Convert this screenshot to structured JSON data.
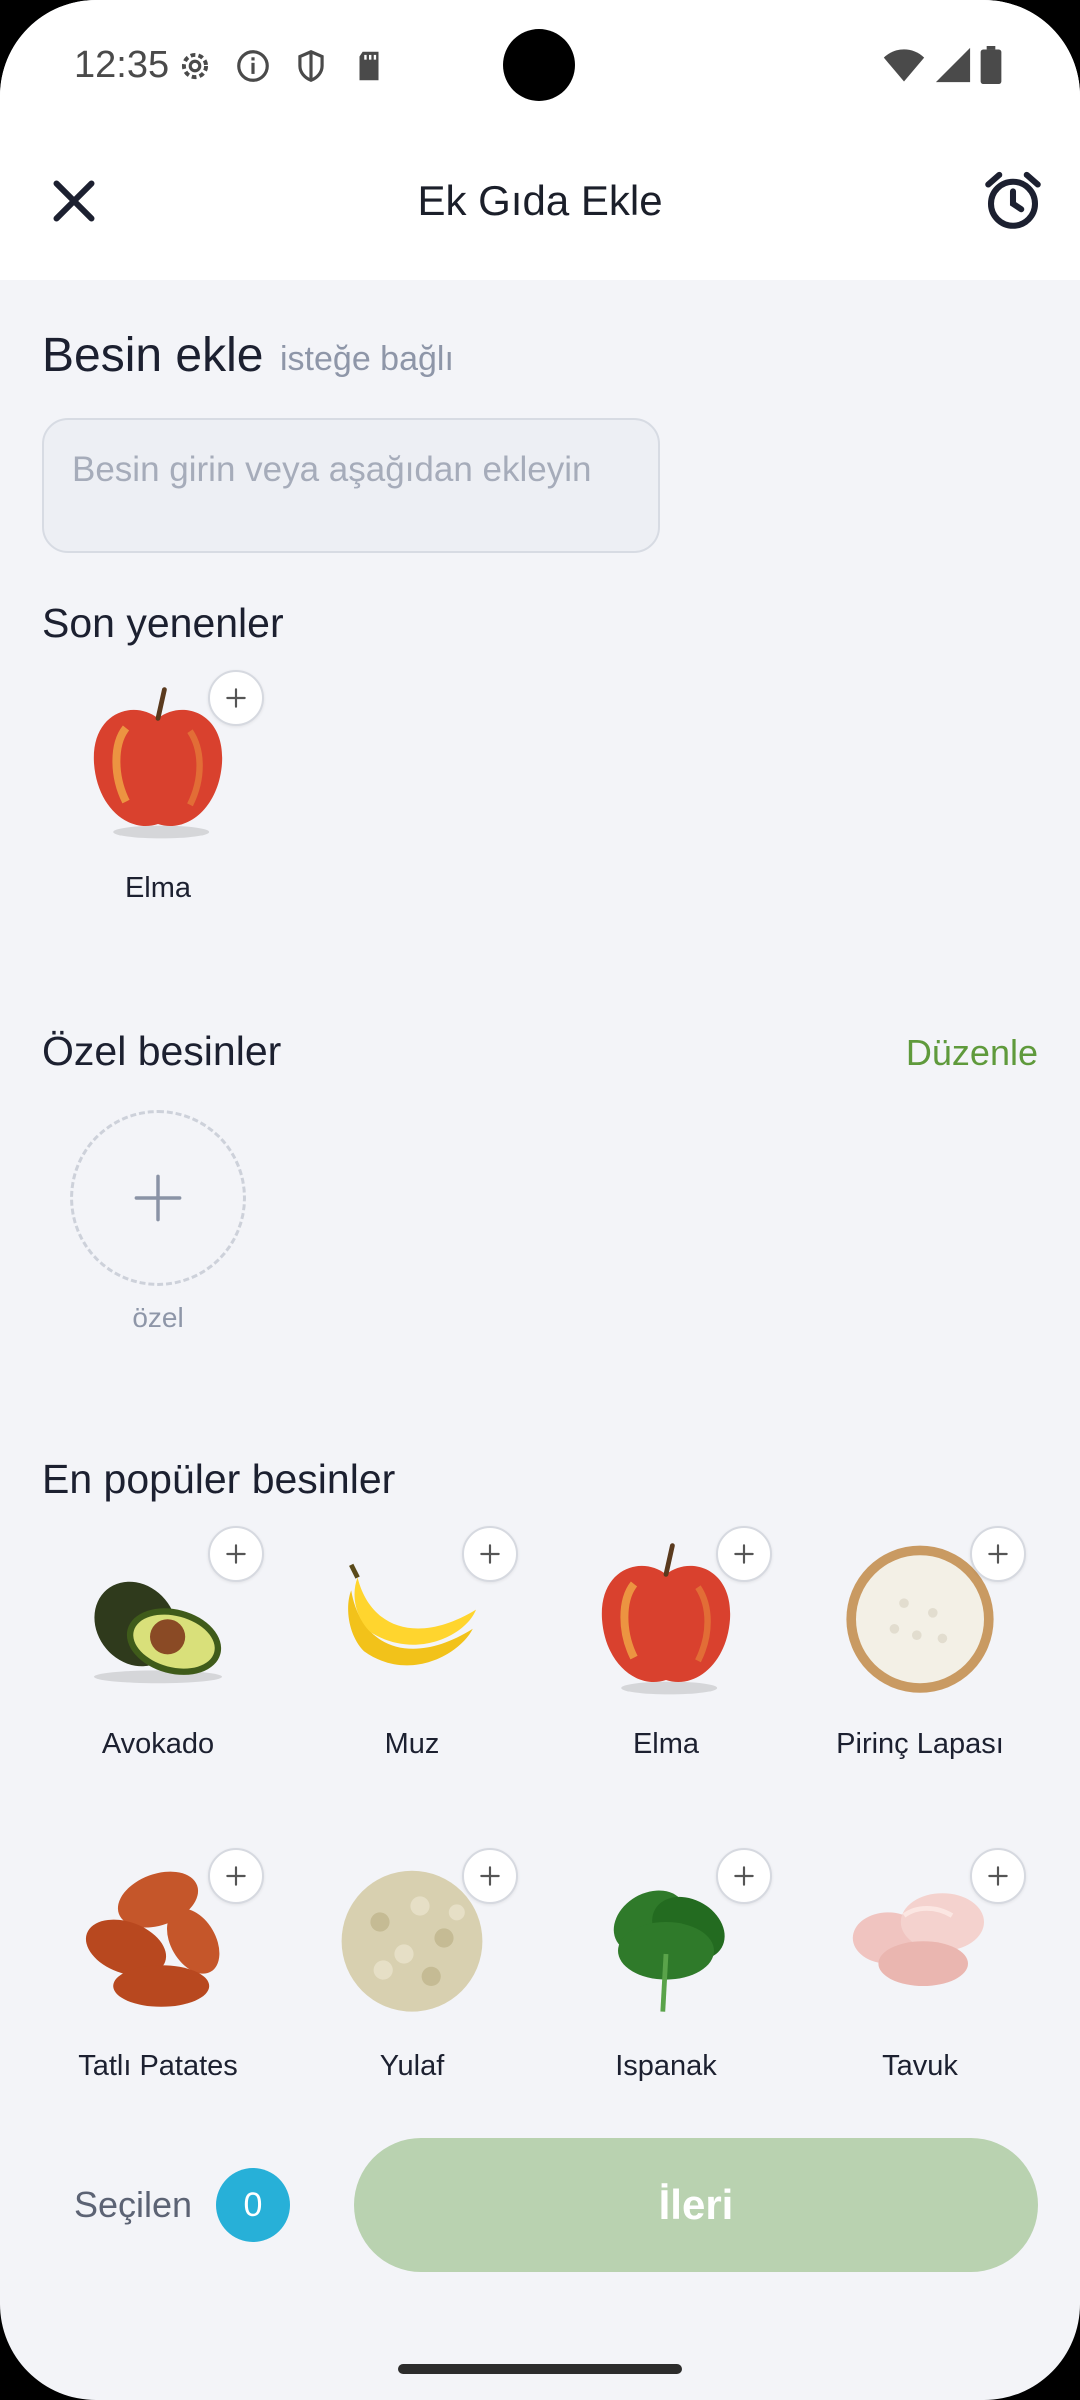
{
  "status_bar": {
    "time": "12:35",
    "left_icons": [
      "settings-icon",
      "info-icon",
      "shield-icon",
      "sd-card-icon"
    ],
    "right_icons": [
      "wifi-icon",
      "signal-icon",
      "battery-icon"
    ]
  },
  "app_bar": {
    "title": "Ek Gıda Ekle",
    "left_icon": "close-icon",
    "right_icon": "alarm-icon"
  },
  "add_food": {
    "title": "Besin ekle",
    "optional": "isteğe bağlı",
    "placeholder": "Besin girin veya aşağıdan ekleyin"
  },
  "recent": {
    "title": "Son yenenler",
    "items": [
      {
        "label": "Elma",
        "icon": "apple"
      }
    ]
  },
  "custom": {
    "title": "Özel besinler",
    "edit_label": "Düzenle",
    "add_label": "özel"
  },
  "popular": {
    "title": "En popüler besinler",
    "items": [
      {
        "label": "Avokado",
        "icon": "avocado"
      },
      {
        "label": "Muz",
        "icon": "banana"
      },
      {
        "label": "Elma",
        "icon": "apple"
      },
      {
        "label": "Pirinç Lapası",
        "icon": "rice"
      },
      {
        "label": "Tatlı Patates",
        "icon": "sweet-potato"
      },
      {
        "label": "Yulaf",
        "icon": "oats"
      },
      {
        "label": "Ispanak",
        "icon": "spinach"
      },
      {
        "label": "Tavuk",
        "icon": "chicken"
      }
    ]
  },
  "bottom": {
    "selected_label": "Seçilen",
    "selected_count": "0",
    "next_label": "İleri"
  },
  "colors": {
    "accent_green": "#5f9a3c",
    "next_button": "#b9d2b0",
    "badge": "#27b0d8",
    "background": "#f3f4f8"
  }
}
